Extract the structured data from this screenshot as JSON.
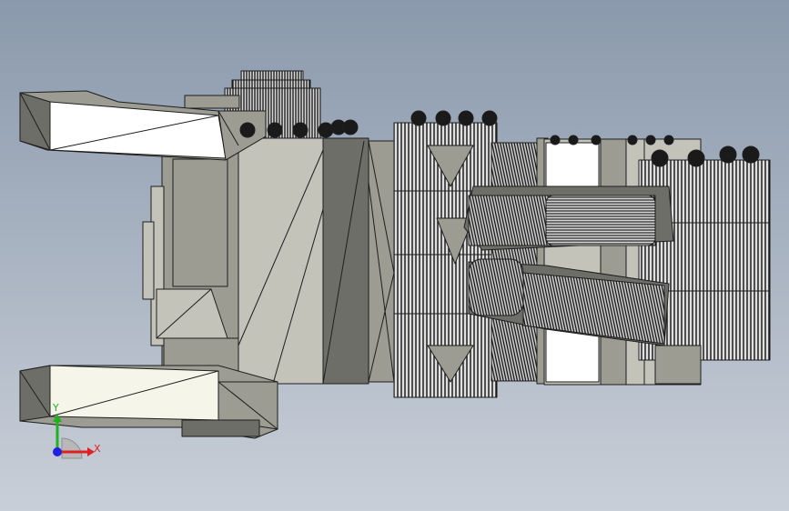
{
  "viewport": {
    "background_top": "#8a99ac",
    "background_bottom": "#c9cfd8"
  },
  "model": {
    "body_light": "#c3c3b9",
    "body_mid": "#9c9c93",
    "body_dark": "#6e6e69",
    "body_white": "#ffffff",
    "body_cream": "#f5f5ea",
    "edge": "#1e1e1e"
  },
  "triad": {
    "x_label": "X",
    "y_label": "Y",
    "x_color": "#e02020",
    "y_color": "#20b020",
    "z_color": "#2020e0"
  }
}
